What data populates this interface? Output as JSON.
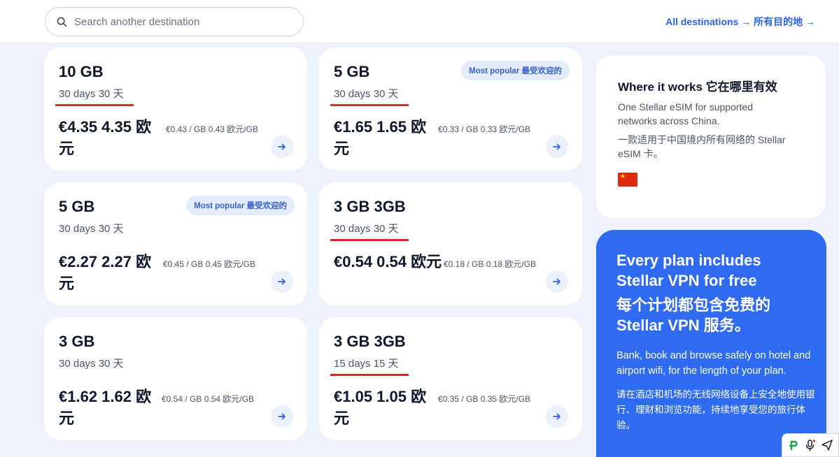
{
  "search": {
    "placeholder": "Search another destination"
  },
  "header": {
    "all_destinations": "All destinations → 所有目的地 →"
  },
  "plans": [
    {
      "gb": "10 GB",
      "days": "30 days  30 天",
      "price": "€4.35  4.35 欧元",
      "per_gb": "€0.43 / GB  0.43 欧元/GB",
      "badge": "",
      "underlined": true
    },
    {
      "gb": "5 GB",
      "days": "30 days  30 天",
      "price": "€1.65  1.65 欧元",
      "per_gb": "€0.33 / GB  0.33 欧元/GB",
      "badge": "Most popular  最受欢迎的",
      "underlined": true
    },
    {
      "gb": "5 GB",
      "days": "30 days  30 天",
      "price": "€2.27  2.27 欧元",
      "per_gb": "€0.45 / GB  0.45 欧元/GB",
      "badge": "Most popular  最受欢迎的",
      "underlined": false
    },
    {
      "gb": "3 GB  3GB",
      "days": "30 days  30 天",
      "price": "€0.54  0.54 欧元",
      "per_gb": "€0.18 / GB  0.18 欧元/GB",
      "badge": "",
      "underlined": true
    },
    {
      "gb": "3 GB",
      "days": "30 days  30 天",
      "price": "€1.62  1.62 欧元",
      "per_gb": "€0.54 / GB  0.54 欧元/GB",
      "badge": "",
      "underlined": false
    },
    {
      "gb": "3 GB  3GB",
      "days": "15 days  15 天",
      "price": "€1.05  1.05 欧元",
      "per_gb": "€0.35 / GB  0.35 欧元/GB",
      "badge": "",
      "underlined": true
    }
  ],
  "where": {
    "title": "Where it works  它在哪里有效",
    "desc_en": "One Stellar eSIM for supported networks across China.",
    "desc_zh": "一款适用于中国境内所有网络的 Stellar eSIM 卡。",
    "flag_icon": "china-flag-icon"
  },
  "vpn": {
    "title_en": "Every plan includes Stellar VPN for free",
    "title_zh": "每个计划都包含免费的 Stellar VPN 服务。",
    "desc_en": "Bank, book and browse safely on hotel and airport wifi, for the length of your plan.",
    "desc_zh": "请在酒店和机场的无线网络设备上安全地使用银行、理财和浏览功能，持续地享受您的旅行体验。"
  },
  "colors": {
    "accent": "#2f6bf0",
    "link": "#2d62e6",
    "underline": "#e0262b",
    "badge_bg": "#e4ebfb"
  }
}
